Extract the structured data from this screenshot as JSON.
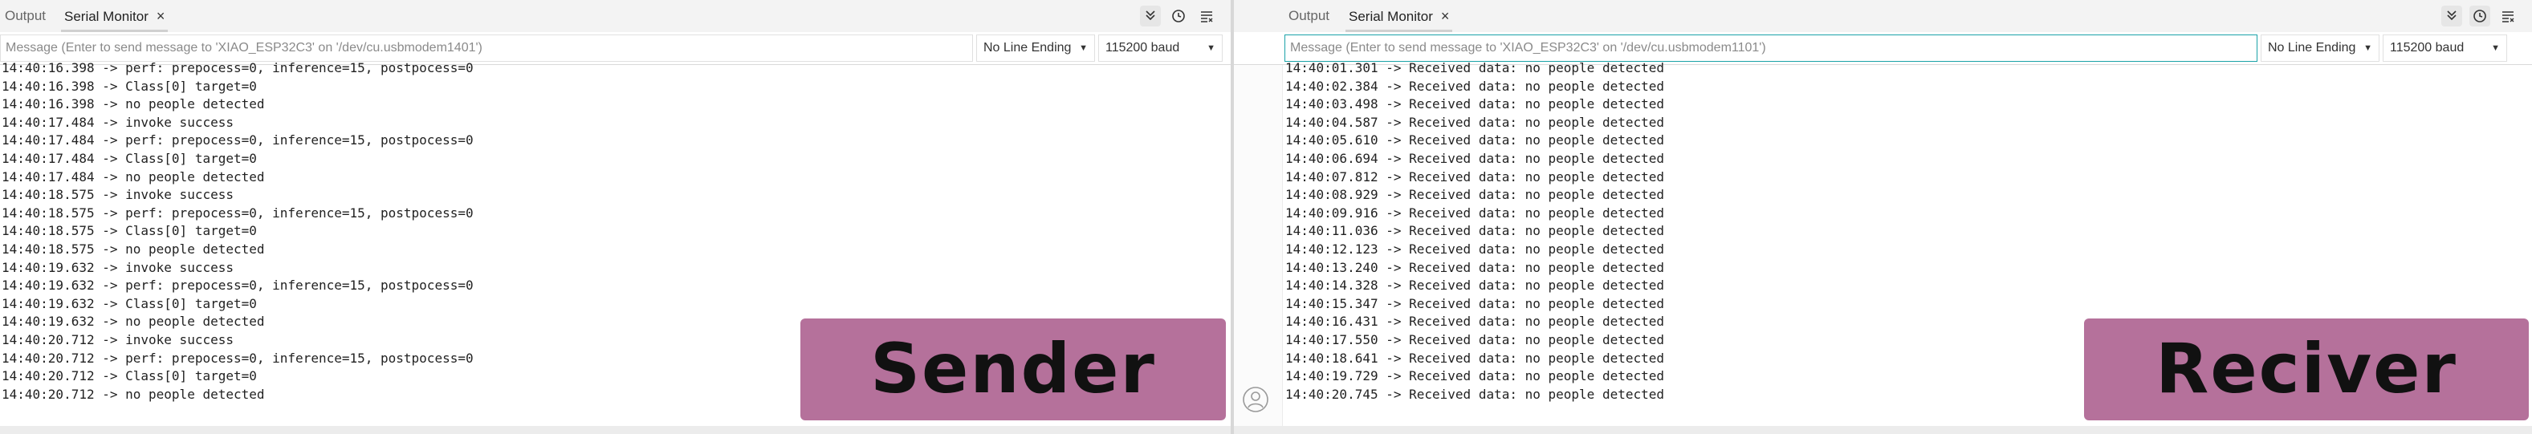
{
  "left": {
    "tabs": {
      "output": "Output",
      "serial_monitor": "Serial Monitor",
      "close": "×"
    },
    "message_placeholder": "Message (Enter to send message to 'XIAO_ESP32C3' on '/dev/cu.usbmodem1401')",
    "line_ending": "No Line Ending",
    "baud": "115200 baud",
    "label": "Sender",
    "log": [
      "14:40:16.398 -> perf: prepocess=0, inference=15, postpocess=0",
      "14:40:16.398 -> Class[0] target=0",
      "14:40:16.398 -> no people detected",
      "14:40:17.484 -> invoke success",
      "14:40:17.484 -> perf: prepocess=0, inference=15, postpocess=0",
      "14:40:17.484 -> Class[0] target=0",
      "14:40:17.484 -> no people detected",
      "14:40:18.575 -> invoke success",
      "14:40:18.575 -> perf: prepocess=0, inference=15, postpocess=0",
      "14:40:18.575 -> Class[0] target=0",
      "14:40:18.575 -> no people detected",
      "14:40:19.632 -> invoke success",
      "14:40:19.632 -> perf: prepocess=0, inference=15, postpocess=0",
      "14:40:19.632 -> Class[0] target=0",
      "14:40:19.632 -> no people detected",
      "14:40:20.712 -> invoke success",
      "14:40:20.712 -> perf: prepocess=0, inference=15, postpocess=0",
      "14:40:20.712 -> Class[0] target=0",
      "14:40:20.712 -> no people detected"
    ]
  },
  "right": {
    "tabs": {
      "output": "Output",
      "serial_monitor": "Serial Monitor",
      "close": "×"
    },
    "message_placeholder": "Message (Enter to send message to 'XIAO_ESP32C3' on '/dev/cu.usbmodem1101')",
    "line_ending": "No Line Ending",
    "baud": "115200 baud",
    "label": "Reciver",
    "log": [
      "14:40:01.301 -> Received data: no people detected",
      "14:40:02.384 -> Received data: no people detected",
      "14:40:03.498 -> Received data: no people detected",
      "14:40:04.587 -> Received data: no people detected",
      "14:40:05.610 -> Received data: no people detected",
      "14:40:06.694 -> Received data: no people detected",
      "14:40:07.812 -> Received data: no people detected",
      "14:40:08.929 -> Received data: no people detected",
      "14:40:09.916 -> Received data: no people detected",
      "14:40:11.036 -> Received data: no people detected",
      "14:40:12.123 -> Received data: no people detected",
      "14:40:13.240 -> Received data: no people detected",
      "14:40:14.328 -> Received data: no people detected",
      "14:40:15.347 -> Received data: no people detected",
      "14:40:16.431 -> Received data: no people detected",
      "14:40:17.550 -> Received data: no people detected",
      "14:40:18.641 -> Received data: no people detected",
      "14:40:19.729 -> Received data: no people detected",
      "14:40:20.745 -> Received data: no people detected"
    ]
  },
  "icons": {
    "autoscroll": "chevron-double-down-icon",
    "timestamp": "clock-icon",
    "clear": "clear-output-icon",
    "account": "account-icon"
  },
  "colors": {
    "label_bg": "#b5719b",
    "focus_border": "#1aa2a8"
  }
}
